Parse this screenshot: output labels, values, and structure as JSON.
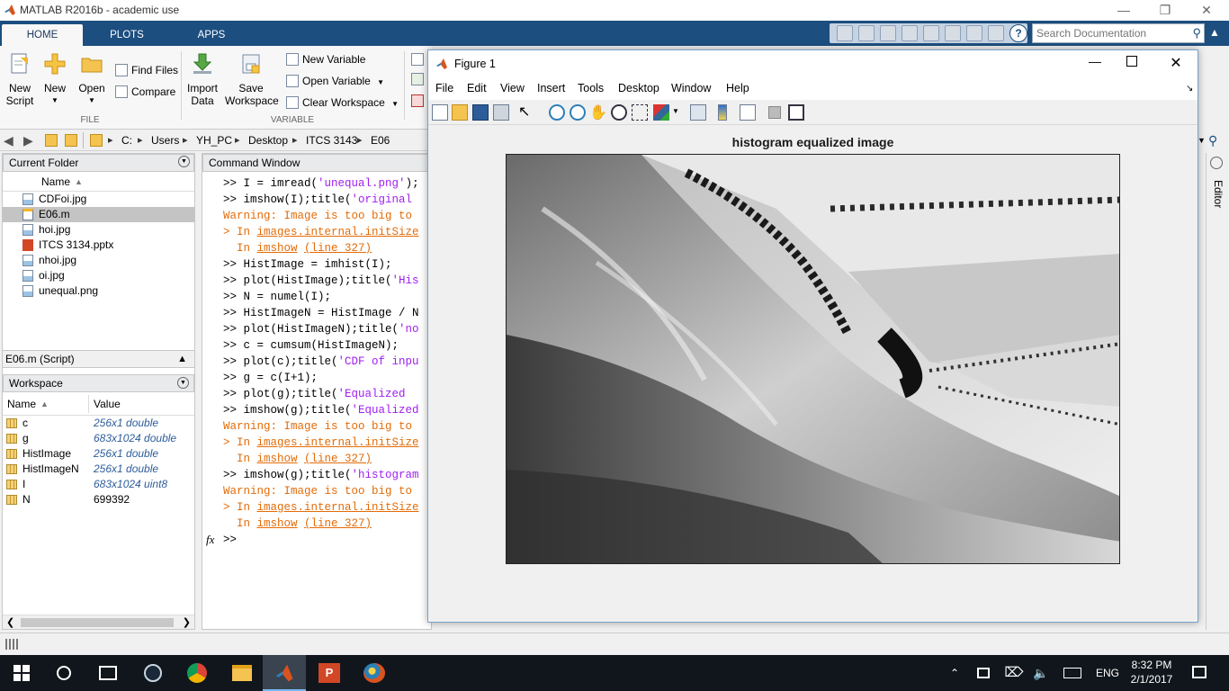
{
  "app": {
    "window_title": "MATLAB R2016b - academic use",
    "colors": {
      "ribbon": "#1c4e7f",
      "warning": "#e36c09",
      "string": "#a020f0",
      "value": "#2e5d9a"
    }
  },
  "ribbon": {
    "tabs": [
      "HOME",
      "PLOTS",
      "APPS"
    ],
    "search_placeholder": "Search Documentation",
    "file_section": {
      "label": "FILE",
      "new_script": "New\nScript",
      "new": "New",
      "open": "Open",
      "find_files": "Find Files",
      "compare": "Compare"
    },
    "variable_section": {
      "label": "VARIABLE",
      "import_data": "Import\nData",
      "save_workspace": "Save\nWorkspace",
      "new_variable": "New Variable",
      "open_variable": "Open Variable",
      "clear_workspace": "Clear Workspace"
    }
  },
  "address_bar": {
    "path": [
      "C:",
      "Users",
      "YH_PC",
      "Desktop",
      "ITCS 3143",
      "E06"
    ]
  },
  "current_folder": {
    "title": "Current Folder",
    "column": "Name",
    "files": [
      {
        "name": "CDFoi.jpg",
        "icon": "image-file-icon",
        "selected": false
      },
      {
        "name": "E06.m",
        "icon": "script-file-icon",
        "selected": true
      },
      {
        "name": "hoi.jpg",
        "icon": "image-file-icon",
        "selected": false
      },
      {
        "name": "ITCS 3134.pptx",
        "icon": "powerpoint-file-icon",
        "selected": false
      },
      {
        "name": "nhoi.jpg",
        "icon": "image-file-icon",
        "selected": false
      },
      {
        "name": "oi.jpg",
        "icon": "image-file-icon",
        "selected": false
      },
      {
        "name": "unequal.png",
        "icon": "image-file-icon",
        "selected": false
      }
    ],
    "details_label": "E06.m  (Script)"
  },
  "workspace": {
    "title": "Workspace",
    "columns": [
      "Name",
      "Value"
    ],
    "vars": [
      {
        "name": "c",
        "value": "256x1 double",
        "italic": true
      },
      {
        "name": "g",
        "value": "683x1024 double",
        "italic": true
      },
      {
        "name": "HistImage",
        "value": "256x1 double",
        "italic": true
      },
      {
        "name": "HistImageN",
        "value": "256x1 double",
        "italic": true
      },
      {
        "name": "I",
        "value": "683x1024 uint8",
        "italic": true
      },
      {
        "name": "N",
        "value": "699392",
        "italic": false
      }
    ]
  },
  "command_window": {
    "title": "Command Window",
    "lines": [
      {
        "type": "cmd",
        "pre": ">> I = imread(",
        "str": "'unequal.png'",
        "post": ");"
      },
      {
        "type": "cmd",
        "pre": ">> imshow(I);title(",
        "str": "'original",
        "post": ""
      },
      {
        "type": "warn",
        "text": "Warning: Image is too big to"
      },
      {
        "type": "link",
        "pre": "> In ",
        "link": "images.internal.initSize",
        "post": ""
      },
      {
        "type": "link",
        "pre": "  In ",
        "link": "imshow",
        "mid": " ",
        "link2": "(line 327)"
      },
      {
        "type": "cmd",
        "pre": ">> HistImage = imhist(I);",
        "str": "",
        "post": ""
      },
      {
        "type": "cmd",
        "pre": ">> plot(HistImage);title(",
        "str": "'His",
        "post": ""
      },
      {
        "type": "cmd",
        "pre": ">> N = numel(I);",
        "str": "",
        "post": ""
      },
      {
        "type": "cmd",
        "pre": ">> HistImageN = HistImage / N",
        "str": "",
        "post": ""
      },
      {
        "type": "cmd",
        "pre": ">> plot(HistImageN);title(",
        "str": "'no",
        "post": ""
      },
      {
        "type": "cmd",
        "pre": ">> c = cumsum(HistImageN);",
        "str": "",
        "post": ""
      },
      {
        "type": "cmd",
        "pre": ">> plot(c);title(",
        "str": "'CDF of inpu",
        "post": ""
      },
      {
        "type": "cmd",
        "pre": ">> g = c(I+1);",
        "str": "",
        "post": ""
      },
      {
        "type": "cmd",
        "pre": ">> plot(g);title(",
        "str": "'Equalized",
        "post": ""
      },
      {
        "type": "cmd",
        "pre": ">> imshow(g);title(",
        "str": "'Equalized",
        "post": ""
      },
      {
        "type": "warn",
        "text": "Warning: Image is too big to"
      },
      {
        "type": "link",
        "pre": "> In ",
        "link": "images.internal.initSize",
        "post": ""
      },
      {
        "type": "link",
        "pre": "  In ",
        "link": "imshow",
        "mid": " ",
        "link2": "(line 327)"
      },
      {
        "type": "cmd",
        "pre": ">> imshow(g);title(",
        "str": "'histogram",
        "post": ""
      },
      {
        "type": "warn",
        "text": "Warning: Image is too big to"
      },
      {
        "type": "link",
        "pre": "> In ",
        "link": "images.internal.initSize",
        "post": ""
      },
      {
        "type": "link",
        "pre": "  In ",
        "link": "imshow",
        "mid": " ",
        "link2": "(line 327)"
      }
    ],
    "prompt": ">>",
    "fx": "fx"
  },
  "right_panel": {
    "editor_label": "Editor"
  },
  "figure": {
    "title": "Figure 1",
    "menus": [
      "File",
      "Edit",
      "View",
      "Insert",
      "Tools",
      "Desktop",
      "Window",
      "Help"
    ],
    "image_title": "histogram equalized image"
  },
  "taskbar": {
    "language": "ENG",
    "time": "8:32 PM",
    "date": "2/1/2017"
  }
}
